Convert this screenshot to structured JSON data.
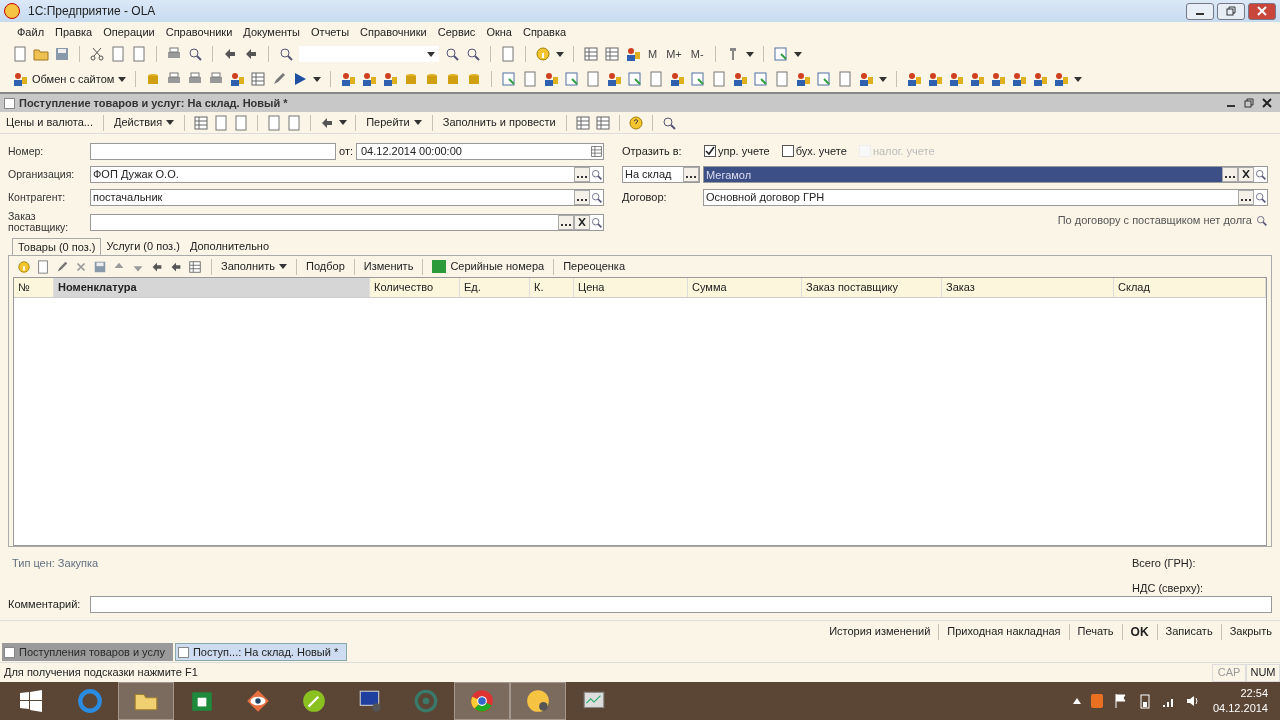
{
  "window": {
    "title": "1С:Предприятие - OLA"
  },
  "menu": [
    "Файл",
    "Правка",
    "Операции",
    "Справочники",
    "Документы",
    "Отчеты",
    "Справочники",
    "Сервис",
    "Окна",
    "Справка"
  ],
  "memory_buttons": [
    "M",
    "M+",
    "M-"
  ],
  "exchange_button": {
    "label": "Обмен с сайтом"
  },
  "document": {
    "title": "Поступление товаров и услуг: На склад. Новый *"
  },
  "doc_toolbar": [
    {
      "kind": "button",
      "label": "Цены и валюта..."
    },
    {
      "kind": "menu",
      "label": "Действия"
    },
    {
      "kind": "menu",
      "label": "Перейти"
    },
    {
      "kind": "button",
      "label": "Заполнить и провести"
    }
  ],
  "header_fields": [
    {
      "label": "Номер:",
      "date_label": "от:",
      "date": "04.12.2014 00:00:00"
    },
    {
      "label": "Организация:",
      "value": "ФОП Дужак О.О."
    },
    {
      "label": "Контрагент:",
      "value": "постачальник"
    },
    {
      "label": "Заказ поставщику:"
    }
  ],
  "reflect": {
    "label": "Отразить в:",
    "options": [
      {
        "label": "упр. учете",
        "checked": true,
        "disabled": false
      },
      {
        "label": "бух. учете",
        "checked": false,
        "disabled": false
      },
      {
        "label": "налог. учете",
        "checked": false,
        "disabled": true
      }
    ]
  },
  "warehouse": {
    "type": "На склад",
    "value": "Мегамол",
    "selected": true
  },
  "contract": {
    "label": "Договор:",
    "value": "Основной договор ГРН"
  },
  "debt_note": "По договору с поставщиком нет долга",
  "tabs": [
    {
      "label": "Товары (0 поз.)",
      "selected": true
    },
    {
      "label": "Услуги (0 поз.)",
      "selected": false
    },
    {
      "label": "Дополнительно",
      "selected": false
    }
  ],
  "table_toolbar": [
    {
      "kind": "menu",
      "label": "Заполнить"
    },
    {
      "kind": "button",
      "label": "Подбор"
    },
    {
      "kind": "button",
      "label": "Изменить"
    },
    {
      "kind": "badge",
      "label": "Серийные номера"
    },
    {
      "kind": "button",
      "label": "Переоценка"
    }
  ],
  "table": {
    "columns": [
      {
        "label": "№",
        "selected": false
      },
      {
        "label": "Номенклатура",
        "selected": true
      },
      {
        "label": "Количество",
        "selected": false
      },
      {
        "label": "Ед.",
        "selected": false
      },
      {
        "label": "К.",
        "selected": false
      },
      {
        "label": "Цена",
        "selected": false
      },
      {
        "label": "Сумма",
        "selected": false
      },
      {
        "label": "Заказ поставщику",
        "selected": false
      },
      {
        "label": "Заказ",
        "selected": false
      },
      {
        "label": "Склад",
        "selected": false
      }
    ]
  },
  "price_type": "Тип цен: Закупка",
  "totals": [
    "Всего (ГРН):",
    "НДС (сверху):"
  ],
  "comment": {
    "label": "Комментарий:"
  },
  "footer_buttons": [
    {
      "kind": "link",
      "label": "История изменений"
    },
    {
      "kind": "link",
      "label": "Приходная накладная"
    },
    {
      "kind": "link",
      "label": "Печать"
    },
    {
      "kind": "default",
      "label": "OK"
    },
    {
      "kind": "link",
      "label": "Записать"
    },
    {
      "kind": "link",
      "label": "Закрыть"
    }
  ],
  "window_tabs": [
    {
      "label": "Поступления товаров и услу",
      "selected": false
    },
    {
      "label": "Поступ...: На склад. Новый *",
      "selected": true
    }
  ],
  "status_bar": {
    "hint": "Для получения подсказки нажмите F1",
    "indicators": [
      {
        "label": "CAP",
        "on": false
      },
      {
        "label": "NUM",
        "on": true
      }
    ]
  },
  "taskbar": {
    "apps": [
      {
        "kind": "ie",
        "selected": false
      },
      {
        "kind": "folder",
        "selected": true
      },
      {
        "kind": "store",
        "selected": false
      },
      {
        "kind": "eye",
        "selected": false
      },
      {
        "kind": "pen",
        "selected": false
      },
      {
        "kind": "monitor",
        "selected": false
      },
      {
        "kind": "shield",
        "selected": false
      },
      {
        "kind": "chrome",
        "selected": true
      },
      {
        "kind": "onec",
        "selected": true
      },
      {
        "kind": "chart",
        "selected": false
      }
    ],
    "time": "22:54",
    "date": "04.12.2014"
  }
}
